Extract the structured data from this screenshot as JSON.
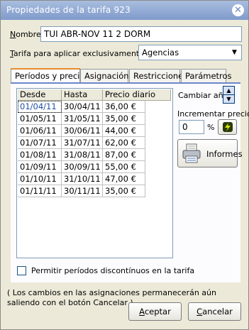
{
  "window": {
    "title": "Propiedades de la tarifa 923",
    "close_symbol": "✕"
  },
  "form": {
    "nombre_label_first": "N",
    "nombre_label_rest": "ombre",
    "nombre_value": "TUI ABR-NOV 11 2 DORM",
    "tarifa_label_first": "T",
    "tarifa_label_rest": "arifa para aplicar exclusivamente a",
    "tarifa_value": "Agencias"
  },
  "tabs": [
    {
      "label": "Períodos y precios",
      "active": true
    },
    {
      "label": "Asignación",
      "active": false
    },
    {
      "label": "Restricciones",
      "active": false
    },
    {
      "label": "Parámetros",
      "active": false
    }
  ],
  "table": {
    "headers": [
      "Desde",
      "Hasta",
      "Precio diario"
    ],
    "rows": [
      [
        "01/04/11",
        "30/04/11",
        "36,00 €"
      ],
      [
        "01/05/11",
        "31/05/11",
        "35,00 €"
      ],
      [
        "01/06/11",
        "30/06/11",
        "44,00 €"
      ],
      [
        "01/07/11",
        "31/07/11",
        "62,00 €"
      ],
      [
        "01/08/11",
        "31/08/11",
        "87,00 €"
      ],
      [
        "01/09/11",
        "30/09/11",
        "55,00 €"
      ],
      [
        "01/10/11",
        "31/10/11",
        "47,00 €"
      ],
      [
        "01/11/11",
        "30/11/11",
        "35,00 €"
      ]
    ]
  },
  "side": {
    "cambiar_ano": "Cambiar año",
    "incrementar_precio": "Incrementar precio",
    "increment_value": "0",
    "percent": "%",
    "informes": "Informes"
  },
  "checkbox_label": "Permitir períodos discontínuos en la tarifa",
  "note": "( Los cambios en las asignaciones permanecerán aún saliendo con el botón Cancelar )",
  "buttons": {
    "aceptar_first": "A",
    "aceptar_rest": "ceptar",
    "cancelar_first": "C",
    "cancelar_rest": "ancelar"
  },
  "colors": {
    "title_bar": "#8fa6d4",
    "tab_accent": "#e68b2c",
    "selected_text": "#1f4fa6"
  }
}
